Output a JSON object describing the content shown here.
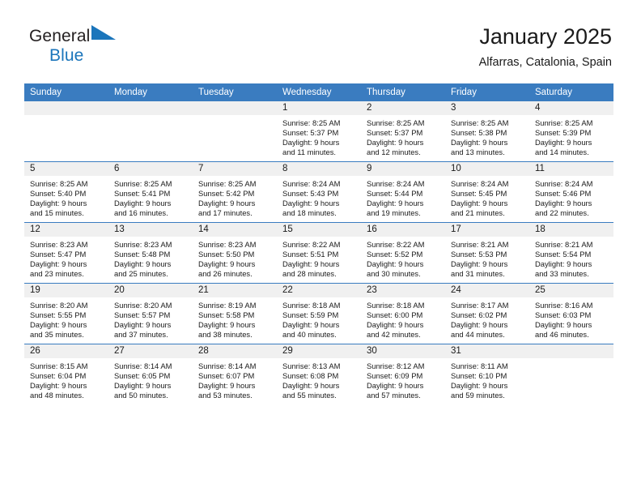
{
  "brand": {
    "name_top": "General",
    "name_bottom": "Blue",
    "flag_color": "#1b75bb",
    "text_color": "#231f20"
  },
  "header": {
    "title": "January 2025",
    "subtitle": "Alfarras, Catalonia, Spain"
  },
  "theme": {
    "header_bg": "#3a7cc0",
    "header_text": "#ffffff",
    "daynum_band_bg": "#f0f0f0",
    "row_divider": "#3a7cc0"
  },
  "calendar": {
    "weekday_headers": [
      "Sunday",
      "Monday",
      "Tuesday",
      "Wednesday",
      "Thursday",
      "Friday",
      "Saturday"
    ],
    "weeks": [
      [
        {
          "day": "",
          "blank": true,
          "lines": []
        },
        {
          "day": "",
          "blank": true,
          "lines": []
        },
        {
          "day": "",
          "blank": true,
          "lines": []
        },
        {
          "day": "1",
          "blank": false,
          "lines": [
            "Sunrise: 8:25 AM",
            "Sunset: 5:37 PM",
            "Daylight: 9 hours",
            "and 11 minutes."
          ]
        },
        {
          "day": "2",
          "blank": false,
          "lines": [
            "Sunrise: 8:25 AM",
            "Sunset: 5:37 PM",
            "Daylight: 9 hours",
            "and 12 minutes."
          ]
        },
        {
          "day": "3",
          "blank": false,
          "lines": [
            "Sunrise: 8:25 AM",
            "Sunset: 5:38 PM",
            "Daylight: 9 hours",
            "and 13 minutes."
          ]
        },
        {
          "day": "4",
          "blank": false,
          "lines": [
            "Sunrise: 8:25 AM",
            "Sunset: 5:39 PM",
            "Daylight: 9 hours",
            "and 14 minutes."
          ]
        }
      ],
      [
        {
          "day": "5",
          "blank": false,
          "lines": [
            "Sunrise: 8:25 AM",
            "Sunset: 5:40 PM",
            "Daylight: 9 hours",
            "and 15 minutes."
          ]
        },
        {
          "day": "6",
          "blank": false,
          "lines": [
            "Sunrise: 8:25 AM",
            "Sunset: 5:41 PM",
            "Daylight: 9 hours",
            "and 16 minutes."
          ]
        },
        {
          "day": "7",
          "blank": false,
          "lines": [
            "Sunrise: 8:25 AM",
            "Sunset: 5:42 PM",
            "Daylight: 9 hours",
            "and 17 minutes."
          ]
        },
        {
          "day": "8",
          "blank": false,
          "lines": [
            "Sunrise: 8:24 AM",
            "Sunset: 5:43 PM",
            "Daylight: 9 hours",
            "and 18 minutes."
          ]
        },
        {
          "day": "9",
          "blank": false,
          "lines": [
            "Sunrise: 8:24 AM",
            "Sunset: 5:44 PM",
            "Daylight: 9 hours",
            "and 19 minutes."
          ]
        },
        {
          "day": "10",
          "blank": false,
          "lines": [
            "Sunrise: 8:24 AM",
            "Sunset: 5:45 PM",
            "Daylight: 9 hours",
            "and 21 minutes."
          ]
        },
        {
          "day": "11",
          "blank": false,
          "lines": [
            "Sunrise: 8:24 AM",
            "Sunset: 5:46 PM",
            "Daylight: 9 hours",
            "and 22 minutes."
          ]
        }
      ],
      [
        {
          "day": "12",
          "blank": false,
          "lines": [
            "Sunrise: 8:23 AM",
            "Sunset: 5:47 PM",
            "Daylight: 9 hours",
            "and 23 minutes."
          ]
        },
        {
          "day": "13",
          "blank": false,
          "lines": [
            "Sunrise: 8:23 AM",
            "Sunset: 5:48 PM",
            "Daylight: 9 hours",
            "and 25 minutes."
          ]
        },
        {
          "day": "14",
          "blank": false,
          "lines": [
            "Sunrise: 8:23 AM",
            "Sunset: 5:50 PM",
            "Daylight: 9 hours",
            "and 26 minutes."
          ]
        },
        {
          "day": "15",
          "blank": false,
          "lines": [
            "Sunrise: 8:22 AM",
            "Sunset: 5:51 PM",
            "Daylight: 9 hours",
            "and 28 minutes."
          ]
        },
        {
          "day": "16",
          "blank": false,
          "lines": [
            "Sunrise: 8:22 AM",
            "Sunset: 5:52 PM",
            "Daylight: 9 hours",
            "and 30 minutes."
          ]
        },
        {
          "day": "17",
          "blank": false,
          "lines": [
            "Sunrise: 8:21 AM",
            "Sunset: 5:53 PM",
            "Daylight: 9 hours",
            "and 31 minutes."
          ]
        },
        {
          "day": "18",
          "blank": false,
          "lines": [
            "Sunrise: 8:21 AM",
            "Sunset: 5:54 PM",
            "Daylight: 9 hours",
            "and 33 minutes."
          ]
        }
      ],
      [
        {
          "day": "19",
          "blank": false,
          "lines": [
            "Sunrise: 8:20 AM",
            "Sunset: 5:55 PM",
            "Daylight: 9 hours",
            "and 35 minutes."
          ]
        },
        {
          "day": "20",
          "blank": false,
          "lines": [
            "Sunrise: 8:20 AM",
            "Sunset: 5:57 PM",
            "Daylight: 9 hours",
            "and 37 minutes."
          ]
        },
        {
          "day": "21",
          "blank": false,
          "lines": [
            "Sunrise: 8:19 AM",
            "Sunset: 5:58 PM",
            "Daylight: 9 hours",
            "and 38 minutes."
          ]
        },
        {
          "day": "22",
          "blank": false,
          "lines": [
            "Sunrise: 8:18 AM",
            "Sunset: 5:59 PM",
            "Daylight: 9 hours",
            "and 40 minutes."
          ]
        },
        {
          "day": "23",
          "blank": false,
          "lines": [
            "Sunrise: 8:18 AM",
            "Sunset: 6:00 PM",
            "Daylight: 9 hours",
            "and 42 minutes."
          ]
        },
        {
          "day": "24",
          "blank": false,
          "lines": [
            "Sunrise: 8:17 AM",
            "Sunset: 6:02 PM",
            "Daylight: 9 hours",
            "and 44 minutes."
          ]
        },
        {
          "day": "25",
          "blank": false,
          "lines": [
            "Sunrise: 8:16 AM",
            "Sunset: 6:03 PM",
            "Daylight: 9 hours",
            "and 46 minutes."
          ]
        }
      ],
      [
        {
          "day": "26",
          "blank": false,
          "lines": [
            "Sunrise: 8:15 AM",
            "Sunset: 6:04 PM",
            "Daylight: 9 hours",
            "and 48 minutes."
          ]
        },
        {
          "day": "27",
          "blank": false,
          "lines": [
            "Sunrise: 8:14 AM",
            "Sunset: 6:05 PM",
            "Daylight: 9 hours",
            "and 50 minutes."
          ]
        },
        {
          "day": "28",
          "blank": false,
          "lines": [
            "Sunrise: 8:14 AM",
            "Sunset: 6:07 PM",
            "Daylight: 9 hours",
            "and 53 minutes."
          ]
        },
        {
          "day": "29",
          "blank": false,
          "lines": [
            "Sunrise: 8:13 AM",
            "Sunset: 6:08 PM",
            "Daylight: 9 hours",
            "and 55 minutes."
          ]
        },
        {
          "day": "30",
          "blank": false,
          "lines": [
            "Sunrise: 8:12 AM",
            "Sunset: 6:09 PM",
            "Daylight: 9 hours",
            "and 57 minutes."
          ]
        },
        {
          "day": "31",
          "blank": false,
          "lines": [
            "Sunrise: 8:11 AM",
            "Sunset: 6:10 PM",
            "Daylight: 9 hours",
            "and 59 minutes."
          ]
        },
        {
          "day": "",
          "blank": true,
          "lines": []
        }
      ]
    ]
  }
}
